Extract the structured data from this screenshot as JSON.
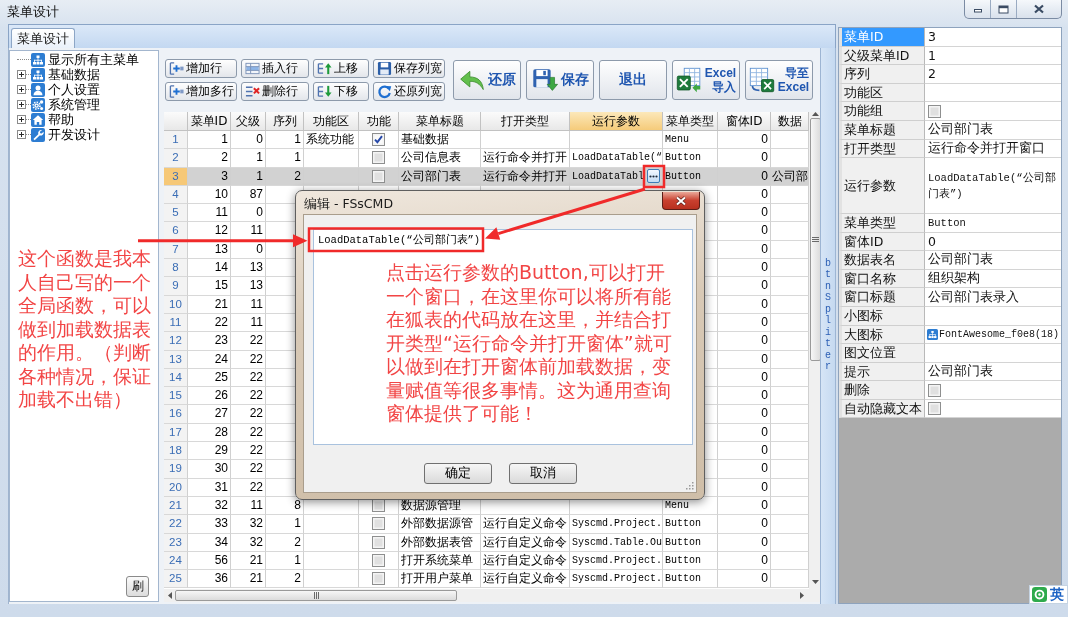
{
  "window": {
    "title": "菜单设计"
  },
  "tabs": [
    {
      "label": "菜单设计",
      "selected": true
    }
  ],
  "tree": {
    "items": [
      {
        "label": "显示所有主菜单",
        "kind": "leaf"
      },
      {
        "label": "基础数据",
        "kind": "branch",
        "expanded": false
      },
      {
        "label": "个人设置",
        "kind": "branch",
        "expanded": false
      },
      {
        "label": "系统管理",
        "kind": "branch",
        "expanded": false
      },
      {
        "label": "帮助",
        "kind": "branch",
        "expanded": false
      },
      {
        "label": "开发设计",
        "kind": "branch",
        "expanded": false
      }
    ],
    "refresh_button": "刷"
  },
  "toolbar": {
    "small_buttons": [
      "增加行",
      "插入行",
      "上移",
      "保存列宽",
      "增加多行",
      "删除行",
      "下移",
      "还原列宽"
    ],
    "large_buttons": [
      {
        "lines": [
          "还原"
        ]
      },
      {
        "lines": [
          "保存"
        ]
      },
      {
        "lines": [
          "退出"
        ]
      },
      {
        "lines": [
          "Excel",
          "导入"
        ]
      },
      {
        "lines": [
          "导至",
          "Excel"
        ]
      }
    ]
  },
  "grid": {
    "columns": [
      {
        "label": "菜单ID",
        "kind": "number",
        "selected": false
      },
      {
        "label": "父级",
        "kind": "number",
        "selected": false
      },
      {
        "label": "序列",
        "kind": "number",
        "selected": false
      },
      {
        "label": "功能区",
        "kind": "text",
        "selected": false
      },
      {
        "label": "功能",
        "kind": "check",
        "selected": false
      },
      {
        "label": "菜单标题",
        "kind": "text",
        "selected": false
      },
      {
        "label": "打开类型",
        "kind": "text",
        "selected": false
      },
      {
        "label": "运行参数",
        "kind": "code",
        "selected": true
      },
      {
        "label": "菜单类型",
        "kind": "code",
        "selected": false
      },
      {
        "label": "窗体ID",
        "kind": "number",
        "selected": false
      },
      {
        "label": "数据",
        "kind": "text",
        "selected": false
      }
    ],
    "rows": [
      {
        "number": "1",
        "selected": false,
        "menu_id": "1",
        "parent_id": "0",
        "order": "1",
        "area": "系统功能",
        "function": true,
        "title": "基础数据",
        "menu_type": "Menu",
        "form_id": "0"
      },
      {
        "number": "2",
        "selected": false,
        "menu_id": "2",
        "parent_id": "1",
        "order": "1",
        "function": false,
        "title": "公司信息表",
        "open_type": "运行命令并打开",
        "run_param": "LoadDataTable(“",
        "menu_type": "Button",
        "form_id": "0"
      },
      {
        "number": "3",
        "selected": true,
        "menu_id": "3",
        "parent_id": "1",
        "order": "2",
        "function": false,
        "title": "公司部门表",
        "open_type": "运行命令并打开",
        "run_param": "LoadDataTabl",
        "menu_type": "Button",
        "form_id": "0",
        "column_11": "公司部"
      },
      {
        "number": "4",
        "selected": false,
        "menu_id": "10",
        "parent_id": "87",
        "form_id": "0"
      },
      {
        "number": "5",
        "selected": false,
        "menu_id": "11",
        "parent_id": "0",
        "form_id": "0"
      },
      {
        "number": "6",
        "selected": false,
        "menu_id": "12",
        "parent_id": "11",
        "form_id": "0"
      },
      {
        "number": "7",
        "selected": false,
        "menu_id": "13",
        "parent_id": "0",
        "form_id": "0"
      },
      {
        "number": "8",
        "selected": false,
        "menu_id": "14",
        "parent_id": "13",
        "form_id": "0"
      },
      {
        "number": "9",
        "selected": false,
        "menu_id": "15",
        "parent_id": "13",
        "form_id": "0"
      },
      {
        "number": "10",
        "selected": false,
        "menu_id": "21",
        "parent_id": "11",
        "form_id": "0"
      },
      {
        "number": "11",
        "selected": false,
        "menu_id": "22",
        "parent_id": "11",
        "form_id": "0"
      },
      {
        "number": "12",
        "selected": false,
        "menu_id": "23",
        "parent_id": "22",
        "form_id": "0"
      },
      {
        "number": "13",
        "selected": false,
        "menu_id": "24",
        "parent_id": "22",
        "form_id": "0"
      },
      {
        "number": "14",
        "selected": false,
        "menu_id": "25",
        "parent_id": "22",
        "form_id": "0"
      },
      {
        "number": "15",
        "selected": false,
        "menu_id": "26",
        "parent_id": "22",
        "form_id": "0"
      },
      {
        "number": "16",
        "selected": false,
        "menu_id": "27",
        "parent_id": "22",
        "form_id": "0"
      },
      {
        "number": "17",
        "selected": false,
        "menu_id": "28",
        "parent_id": "22",
        "form_id": "0"
      },
      {
        "number": "18",
        "selected": false,
        "menu_id": "29",
        "parent_id": "22",
        "form_id": "0"
      },
      {
        "number": "19",
        "selected": false,
        "menu_id": "30",
        "parent_id": "22",
        "form_id": "0"
      },
      {
        "number": "20",
        "selected": false,
        "menu_id": "31",
        "parent_id": "22",
        "form_id": "0"
      },
      {
        "number": "21",
        "selected": false,
        "menu_id": "32",
        "parent_id": "11",
        "order": "8",
        "function": false,
        "title": "数据源管理",
        "menu_type": "Menu",
        "form_id": "0"
      },
      {
        "number": "22",
        "selected": false,
        "menu_id": "33",
        "parent_id": "32",
        "order": "1",
        "function": false,
        "title": "外部数据源管",
        "open_type": "运行自定义命令",
        "run_param": "Syscmd.Project.",
        "menu_type": "Button",
        "form_id": "0"
      },
      {
        "number": "23",
        "selected": false,
        "menu_id": "34",
        "parent_id": "32",
        "order": "2",
        "function": false,
        "title": "外部数据表管",
        "open_type": "运行自定义命令",
        "run_param": "Syscmd.Table.Ou",
        "menu_type": "Button",
        "form_id": "0"
      },
      {
        "number": "24",
        "selected": false,
        "menu_id": "56",
        "parent_id": "21",
        "order": "1",
        "function": false,
        "title": "打开系统菜单",
        "open_type": "运行自定义命令",
        "run_param": "Syscmd.Project.",
        "menu_type": "Button",
        "form_id": "0"
      },
      {
        "number": "25",
        "selected": false,
        "menu_id": "36",
        "parent_id": "21",
        "order": "2",
        "function": false,
        "title": "打开用户菜单",
        "open_type": "运行自定义命令",
        "run_param": "Syscmd.Project.",
        "menu_type": "Button",
        "form_id": "0"
      }
    ]
  },
  "splitter": {
    "label": "btnSpliter"
  },
  "properties": [
    {
      "label": "菜单ID",
      "value": "3",
      "kind": "text",
      "selected": true
    },
    {
      "label": "父级菜单ID",
      "value": "1",
      "kind": "text",
      "selected": false
    },
    {
      "label": "序列",
      "value": "2",
      "kind": "text",
      "selected": false
    },
    {
      "label": "功能区",
      "kind": "text",
      "selected": false
    },
    {
      "label": "功能组",
      "kind": "check",
      "checked": false,
      "selected": false
    },
    {
      "label": "菜单标题",
      "value": "公司部门表",
      "kind": "text",
      "selected": false
    },
    {
      "label": "打开类型",
      "value": "运行命令并打开窗口",
      "kind": "text",
      "selected": false
    },
    {
      "label": "运行参数",
      "value": "LoadDataTable(“公司部门表”)",
      "kind": "memo",
      "selected": false
    },
    {
      "label": "菜单类型",
      "value": "Button",
      "kind": "code",
      "selected": false
    },
    {
      "label": "窗体ID",
      "value": "0",
      "kind": "text",
      "selected": false
    },
    {
      "label": "数据表名",
      "value": "公司部门表",
      "kind": "text",
      "selected": false
    },
    {
      "label": "窗口名称",
      "value": "组织架构",
      "kind": "text",
      "selected": false
    },
    {
      "label": "窗口标题",
      "value": "公司部门表录入",
      "kind": "text",
      "selected": false
    },
    {
      "label": "小图标",
      "kind": "text",
      "selected": false
    },
    {
      "label": "大图标",
      "value": "FontAwesome_f0e8(18)",
      "kind": "icon",
      "selected": false
    },
    {
      "label": "图文位置",
      "kind": "text",
      "selected": false
    },
    {
      "label": "提示",
      "value": "公司部门表",
      "kind": "text",
      "selected": false
    },
    {
      "label": "删除",
      "kind": "check",
      "checked": false,
      "selected": false
    },
    {
      "label": "自动隐藏文本",
      "kind": "check",
      "checked": false,
      "selected": false
    }
  ],
  "dialog": {
    "title": "编辑 - FSsCMD",
    "code": "LoadDataTable(“公司部门表”)",
    "buttons": [
      "确定",
      "取消"
    ]
  },
  "notes": [
    "这个函数是我本人自己写的一个全局函数，可以做到加载数据表的作用。（判断各种情况，保证加载不出错）",
    "点击运行参数的Button,可以打开一个窗口，在这里你可以将所有能在狐表的代码放在这里，并结合打开类型“运行命令并打开窗体”就可以做到在打开窗体前加载数据，变量赋值等很多事情。这为通用查询窗体提供了可能！"
  ],
  "ime": {
    "label": "英"
  }
}
